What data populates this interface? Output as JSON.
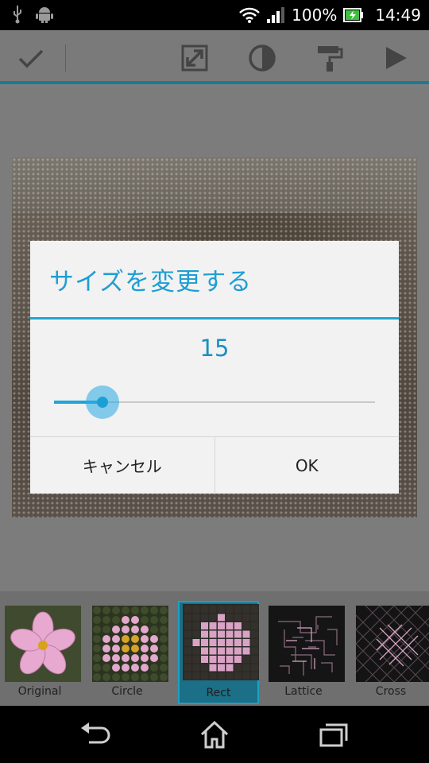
{
  "status_bar": {
    "battery_percent": "100%",
    "time": "14:49",
    "icons": [
      "usb-icon",
      "android-debug-icon",
      "wifi-icon",
      "signal-icon",
      "battery-charging-icon"
    ]
  },
  "action_bar": {
    "icons": [
      "check-icon",
      "resize-icon",
      "contrast-icon",
      "paint-roller-icon",
      "play-icon"
    ]
  },
  "dialog": {
    "title": "サイズを変更する",
    "value": "15",
    "slider_fraction": 0.15,
    "cancel_label": "キャンセル",
    "ok_label": "OK"
  },
  "filters": {
    "items": [
      {
        "label": "Original",
        "selected": false
      },
      {
        "label": "Circle",
        "selected": false
      },
      {
        "label": "Rect",
        "selected": true
      },
      {
        "label": "Lattice",
        "selected": false
      },
      {
        "label": "Cross",
        "selected": false
      }
    ]
  },
  "nav_bar": {
    "icons": [
      "back-icon",
      "home-icon",
      "recent-apps-icon"
    ]
  }
}
